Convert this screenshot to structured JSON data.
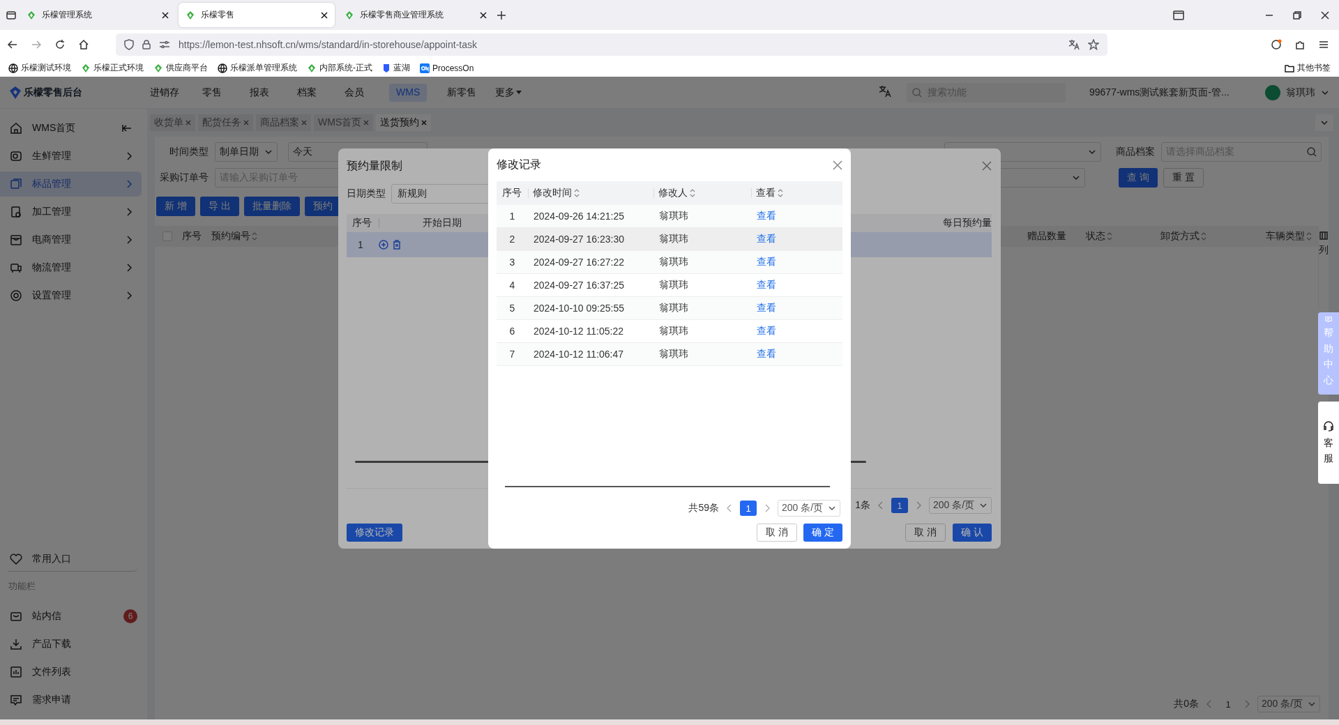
{
  "browser": {
    "tabs": [
      {
        "title": "乐檬管理系统",
        "selected": false
      },
      {
        "title": "乐檬零售",
        "selected": true
      },
      {
        "title": "乐檬零售商业管理系统",
        "selected": false
      }
    ],
    "url": "https://lemon-test.nhsoft.cn/wms/standard/in-storehouse/appoint-task",
    "bookmarks": [
      {
        "label": "乐檬测试环境",
        "kind": "globe"
      },
      {
        "label": "乐檬正式环境",
        "kind": "leaf"
      },
      {
        "label": "供应商平台",
        "kind": "leaf"
      },
      {
        "label": "乐檬派单管理系统",
        "kind": "globe"
      },
      {
        "label": "内部系统-正式",
        "kind": "leaf"
      },
      {
        "label": "蓝湖",
        "kind": "lanhu"
      },
      {
        "label": "ProcessOn",
        "kind": "on"
      }
    ],
    "other_bookmarks": "其他书签"
  },
  "header": {
    "logo": "乐檬零售后台",
    "nav": [
      {
        "label": "进销存",
        "selected": false
      },
      {
        "label": "零售",
        "selected": false
      },
      {
        "label": "报表",
        "selected": false
      },
      {
        "label": "档案",
        "selected": false
      },
      {
        "label": "会员",
        "selected": false
      },
      {
        "label": "WMS",
        "selected": true
      },
      {
        "label": "新零售",
        "selected": false
      }
    ],
    "more": "更多",
    "search": {
      "placeholder": "搜索功能"
    },
    "account": "99677-wms测试账套新页面-管...",
    "user": "翁琪玮"
  },
  "sidebar": {
    "items": [
      {
        "label": "WMS首页",
        "selected": false
      },
      {
        "label": "生鲜管理",
        "selected": false
      },
      {
        "label": "标品管理",
        "selected": true
      },
      {
        "label": "加工管理",
        "selected": false
      },
      {
        "label": "电商管理",
        "selected": false
      },
      {
        "label": "物流管理",
        "selected": false
      },
      {
        "label": "设置管理",
        "selected": false
      }
    ],
    "favorites": "常用入口",
    "section": "功能栏",
    "tools": [
      {
        "label": "站内信",
        "badge": "6"
      },
      {
        "label": "产品下载"
      },
      {
        "label": "文件列表"
      },
      {
        "label": "需求申请"
      }
    ]
  },
  "main": {
    "page_tabs": [
      {
        "label": "收货单",
        "selected": false
      },
      {
        "label": "配货任务",
        "selected": false
      },
      {
        "label": "商品档案",
        "selected": false
      },
      {
        "label": "WMS首页",
        "selected": false
      },
      {
        "label": "送货预约",
        "selected": true
      }
    ],
    "time_type": {
      "label": "时间类型",
      "value": "制单日期"
    },
    "period": {
      "value": "今天"
    },
    "order_no": {
      "label": "采购订单号",
      "placeholder": "请输入采购订单号"
    },
    "product": {
      "label": "商品档案",
      "placeholder": "请选择商品档案"
    },
    "query_button": "查 询",
    "reset_button": "重 置",
    "buttons": [
      "新 增",
      "导 出",
      "批量删除",
      "预约"
    ],
    "select_all": {
      "checked": false
    },
    "columns": [
      {
        "label": "序号",
        "sortable": false
      },
      {
        "label": "预约编号",
        "sortable": true
      },
      {
        "label": "赠品数量",
        "sortable": false
      },
      {
        "label": "状态",
        "sortable": true
      },
      {
        "label": "卸货方式",
        "sortable": true
      },
      {
        "label": "车辆类型",
        "sortable": true
      }
    ],
    "column_settings": "列",
    "pagination": {
      "total": "共0条",
      "page": "1",
      "page_size": "200 条/页"
    }
  },
  "help": {
    "help_center": "帮助中心",
    "service": "客服"
  },
  "limit_modal": {
    "title": "预约量限制",
    "date_type": {
      "label": "日期类型",
      "value": "新规则"
    },
    "columns": [
      "序号",
      "开始日期",
      "每日预约量"
    ],
    "rows": [
      {
        "index": "1",
        "selected": true
      }
    ],
    "pagination": {
      "total": "1条",
      "page": "1",
      "page_size": "200 条/页"
    },
    "cancel": "取 消",
    "confirm": "确 认",
    "history_button": "修改记录"
  },
  "record_modal": {
    "title": "修改记录",
    "columns": [
      "序号",
      "修改时间",
      "修改人",
      "查看"
    ],
    "rows": [
      {
        "index": "1",
        "time": "2024-09-26 14:21:25",
        "user": "翁琪玮",
        "action": "查看",
        "selected": false
      },
      {
        "index": "2",
        "time": "2024-09-27 16:23:30",
        "user": "翁琪玮",
        "action": "查看",
        "selected": true
      },
      {
        "index": "3",
        "time": "2024-09-27 16:27:22",
        "user": "翁琪玮",
        "action": "查看",
        "selected": false
      },
      {
        "index": "4",
        "time": "2024-09-27 16:37:25",
        "user": "翁琪玮",
        "action": "查看",
        "selected": false
      },
      {
        "index": "5",
        "time": "2024-10-10 09:25:55",
        "user": "翁琪玮",
        "action": "查看",
        "selected": false
      },
      {
        "index": "6",
        "time": "2024-10-12 11:05:22",
        "user": "翁琪玮",
        "action": "查看",
        "selected": false
      },
      {
        "index": "7",
        "time": "2024-10-12 11:06:47",
        "user": "翁琪玮",
        "action": "查看",
        "selected": false
      }
    ],
    "pagination": {
      "total": "共59条",
      "page": "1",
      "page_size": "200 条/页"
    },
    "cancel": "取 消",
    "confirm": "确 定"
  }
}
